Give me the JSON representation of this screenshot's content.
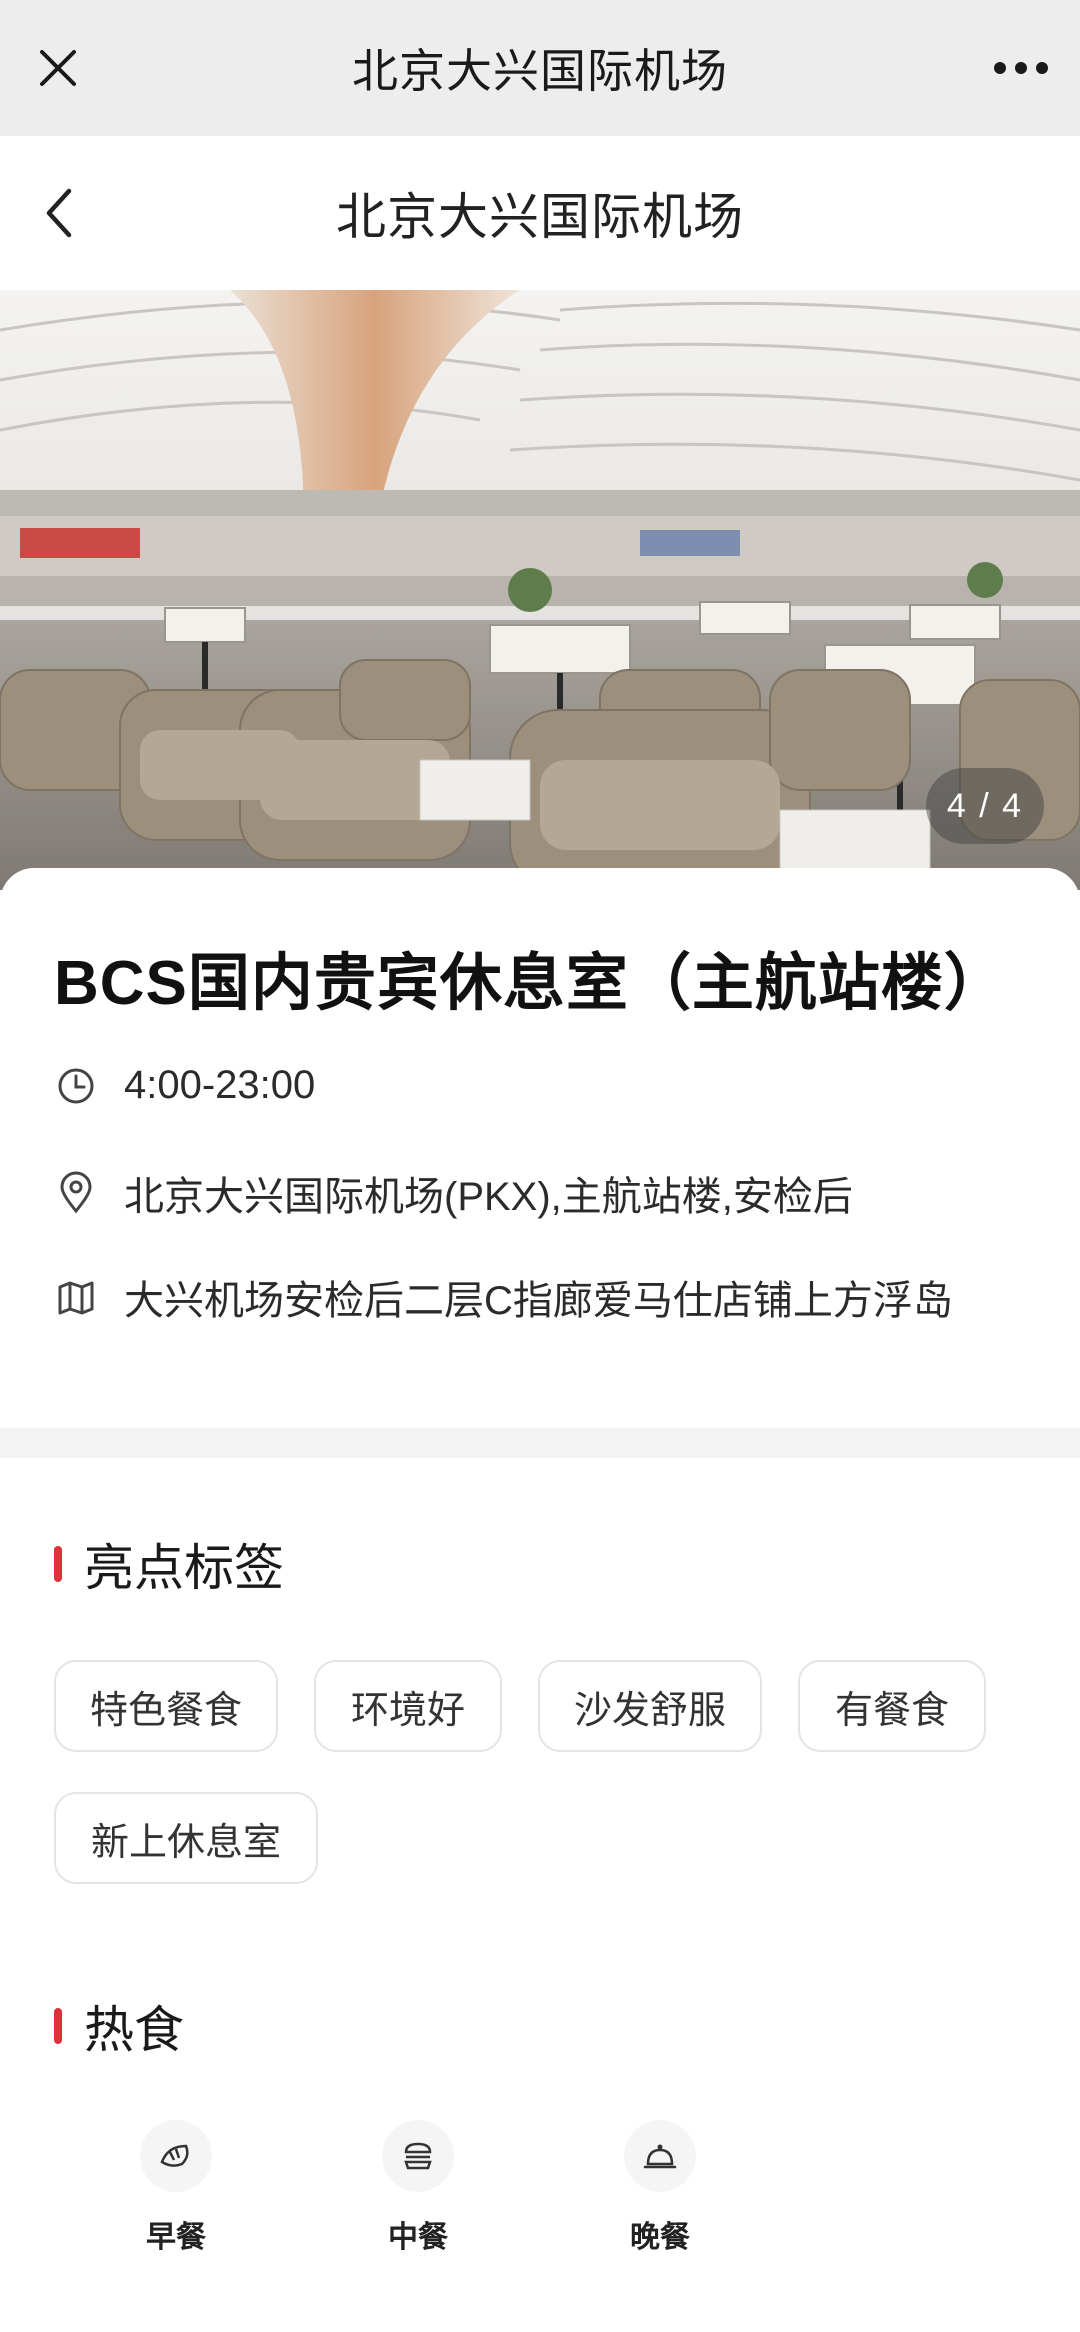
{
  "topbar": {
    "title": "北京大兴国际机场"
  },
  "navbar": {
    "title": "北京大兴国际机场"
  },
  "gallery": {
    "counter": "4 / 4"
  },
  "lounge": {
    "name": "BCS国内贵宾休息室（主航站楼）",
    "hours": "4:00-23:00",
    "address": "北京大兴国际机场(PKX),主航站楼,安检后",
    "location": "大兴机场安检后二层C指廊爱马仕店铺上方浮岛"
  },
  "highlights": {
    "title": "亮点标签",
    "tags": [
      "特色餐食",
      "环境好",
      "沙发舒服",
      "有餐食",
      "新上休息室"
    ]
  },
  "hot_food": {
    "title": "热食",
    "meals": [
      {
        "label": "早餐",
        "icon": "croissant-icon"
      },
      {
        "label": "中餐",
        "icon": "burger-icon"
      },
      {
        "label": "晚餐",
        "icon": "cloche-icon"
      }
    ]
  },
  "colors": {
    "accent": "#e0303a",
    "topbar_bg": "#ededed",
    "band": "#f3f3f3"
  }
}
